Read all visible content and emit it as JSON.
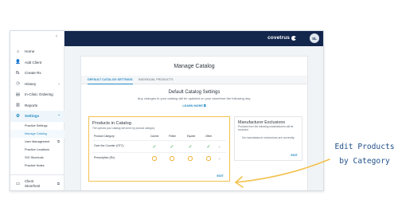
{
  "sidebar": {
    "collapse_glyph": "‹",
    "items": [
      {
        "label": "Home",
        "icon": "home-icon",
        "glyph": "⌂"
      },
      {
        "label": "Add Client",
        "icon": "add-user-icon",
        "glyph": "👤"
      },
      {
        "label": "Create Rx",
        "icon": "prescription-icon",
        "glyph": "℞"
      },
      {
        "label": "History",
        "icon": "history-icon",
        "glyph": "◷",
        "chevron": "⌄"
      },
      {
        "label": "In-Clinic Ordering",
        "icon": "clinic-icon",
        "glyph": "▤"
      },
      {
        "label": "Reports",
        "icon": "reports-icon",
        "glyph": "▥"
      },
      {
        "label": "Settings",
        "icon": "gear-icon",
        "glyph": "⚙",
        "chevron": "⌃"
      }
    ],
    "subitems": [
      {
        "label": "Practice Settings"
      },
      {
        "label": "Manage Catalog"
      },
      {
        "label": "User Management",
        "icon": "external-link-icon",
        "glyph": "⧉"
      },
      {
        "label": "Practice Locations"
      },
      {
        "label": "SIG Shortcuts"
      },
      {
        "label": "Practice Notes"
      }
    ],
    "bottom": {
      "label": "Client Storefront",
      "icon": "storefront-icon",
      "glyph": "▭",
      "ext_glyph": "⧉"
    }
  },
  "topbar": {
    "brand": "covetrus",
    "avatar": "SL"
  },
  "page": {
    "title": "Manage Catalog",
    "tabs": [
      "Default Catalog Settings",
      "Individual Products"
    ],
    "section_title": "Default Catalog Settings",
    "section_subtitle": "Any changes to your catalog will be updated on your storefront the following day.",
    "learn_more": "LEARN MORE ⧉"
  },
  "products": {
    "title": "Products in Catalog",
    "subtitle": "The species your catalog will serve by product category",
    "columns": [
      "Product Category",
      "Canine",
      "Feline",
      "Equine",
      "Other"
    ],
    "rows": [
      {
        "name": "Over the Counter (OTC)",
        "cells": [
          "check",
          "check",
          "check",
          "check"
        ]
      },
      {
        "name": "Prescription (Rx)",
        "cells": [
          "circle",
          "circle",
          "circle",
          "circle"
        ]
      }
    ],
    "edit": "EDIT",
    "colors": {
      "check": "#2fa84f",
      "circle": "#f2b23a",
      "highlight": "#f2c14e"
    }
  },
  "manufacturer": {
    "title": "Manufacturer Exclusions",
    "subtitle": "Products from the following manufacturers will be excluded",
    "empty": "No manufacturer exclusions are currently.",
    "edit": "EDIT"
  },
  "annotation": {
    "line1": "Edit Products",
    "line2": "by Category"
  },
  "colors": {
    "nav_bar": "#13264c",
    "accent": "#2b8cc4",
    "annotation": "#1f4f8a"
  }
}
